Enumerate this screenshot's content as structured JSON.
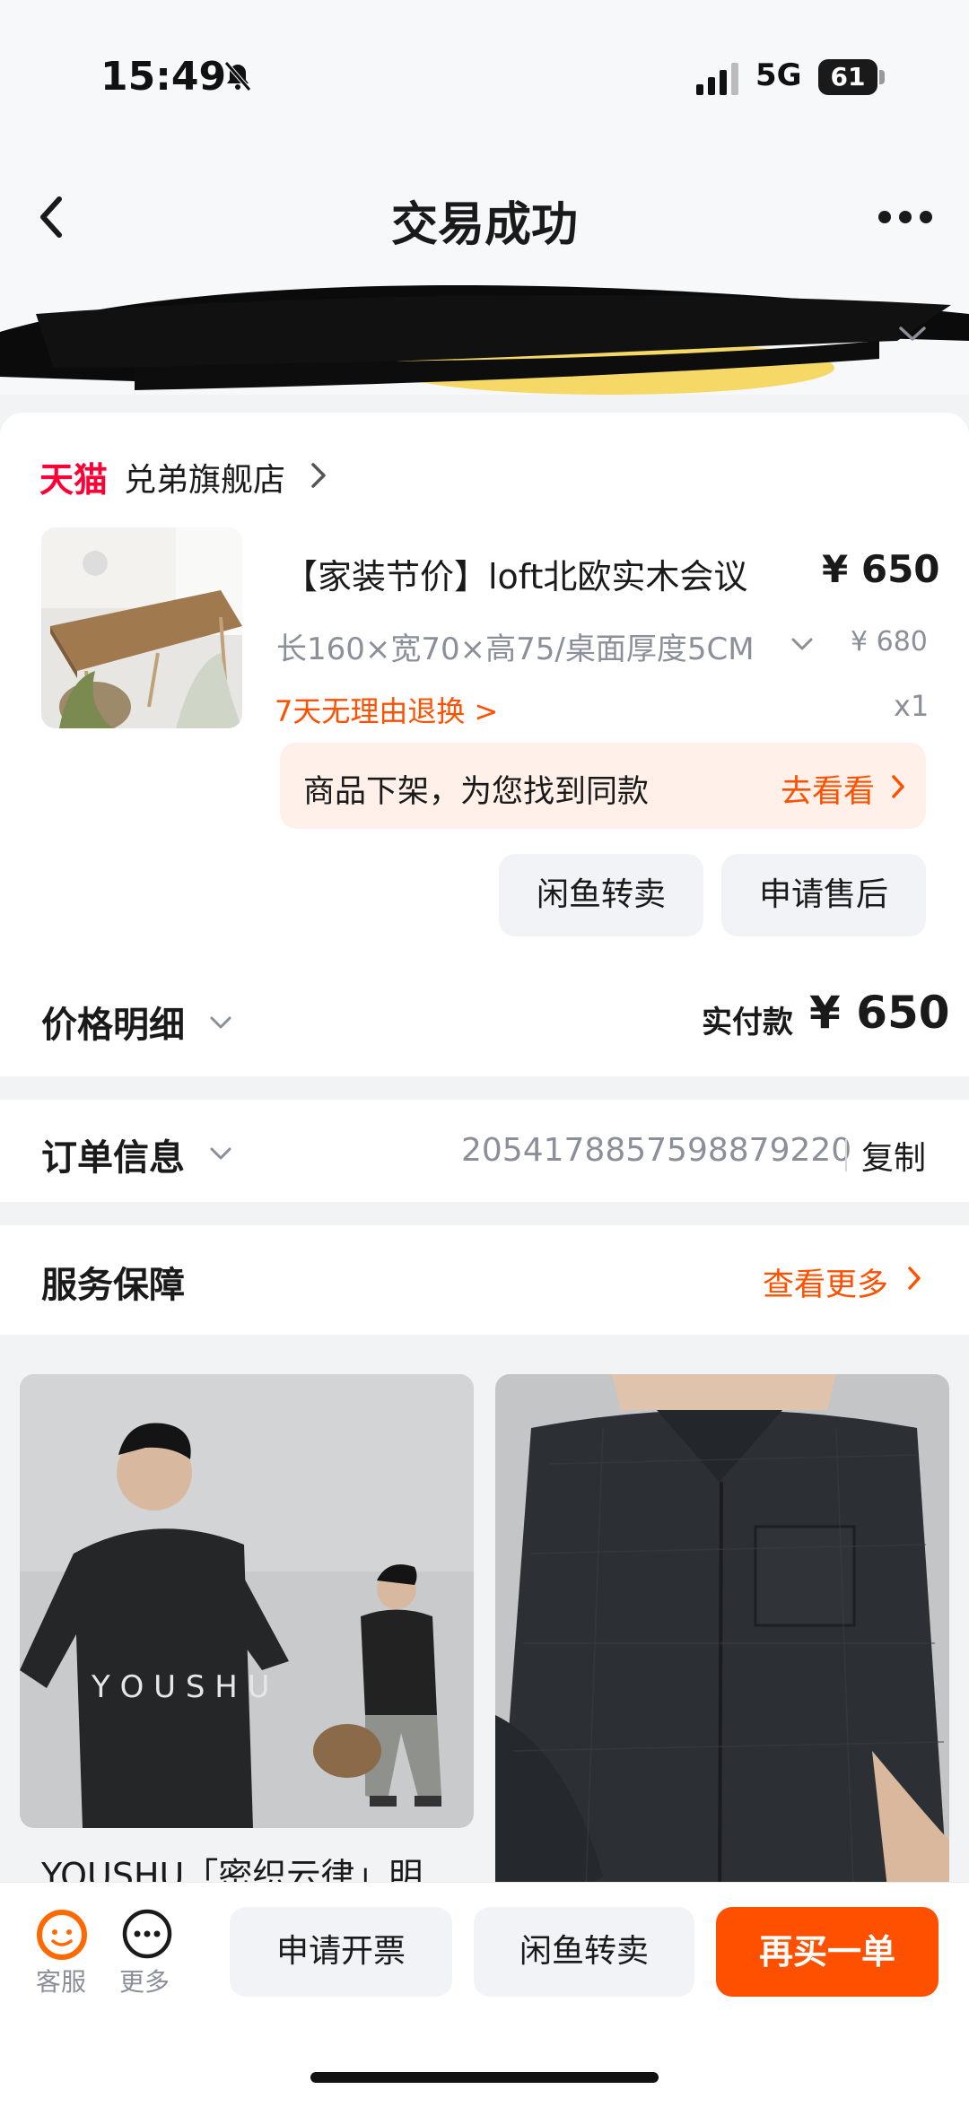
{
  "status_bar": {
    "time": "15:49",
    "network": "5G",
    "battery": "61"
  },
  "nav": {
    "title": "交易成功"
  },
  "address": {
    "text": ""
  },
  "shop": {
    "platform": "天猫",
    "name": "兑弟旗舰店"
  },
  "product": {
    "name": "【家装节价】loft北欧实木会议",
    "price": "¥ 650",
    "sku": "长160×宽70×高75/桌面厚度5CM",
    "original_price": "¥ 680",
    "returns_policy": "7天无理由退换",
    "returns_suffix": ">",
    "quantity": "x1"
  },
  "alert": {
    "text": "商品下架，为您找到同款",
    "link": "去看看"
  },
  "product_actions": {
    "resell": "闲鱼转卖",
    "after_sales": "申请售后"
  },
  "price_detail": {
    "label": "价格明细",
    "paid_label": "实付款",
    "paid_amount": "¥ 650"
  },
  "order_info": {
    "label": "订单信息",
    "order_no": "2054178857598879220",
    "copy": "复制"
  },
  "service": {
    "label": "服务保障",
    "more": "查看更多"
  },
  "recommendations": [
    {
      "title": "YOUSHU「密织云律」明",
      "brand_text": "Y O U S H U"
    },
    {
      "title": ""
    }
  ],
  "bottom_bar": {
    "customer_service": "客服",
    "more": "更多",
    "invoice": "申请开票",
    "resell": "闲鱼转卖",
    "buy_again": "再买一单"
  },
  "colors": {
    "accent": "#ff5000",
    "tmall_red": "#ff0036",
    "muted": "#8a8f99",
    "background": "#f2f3f5"
  }
}
